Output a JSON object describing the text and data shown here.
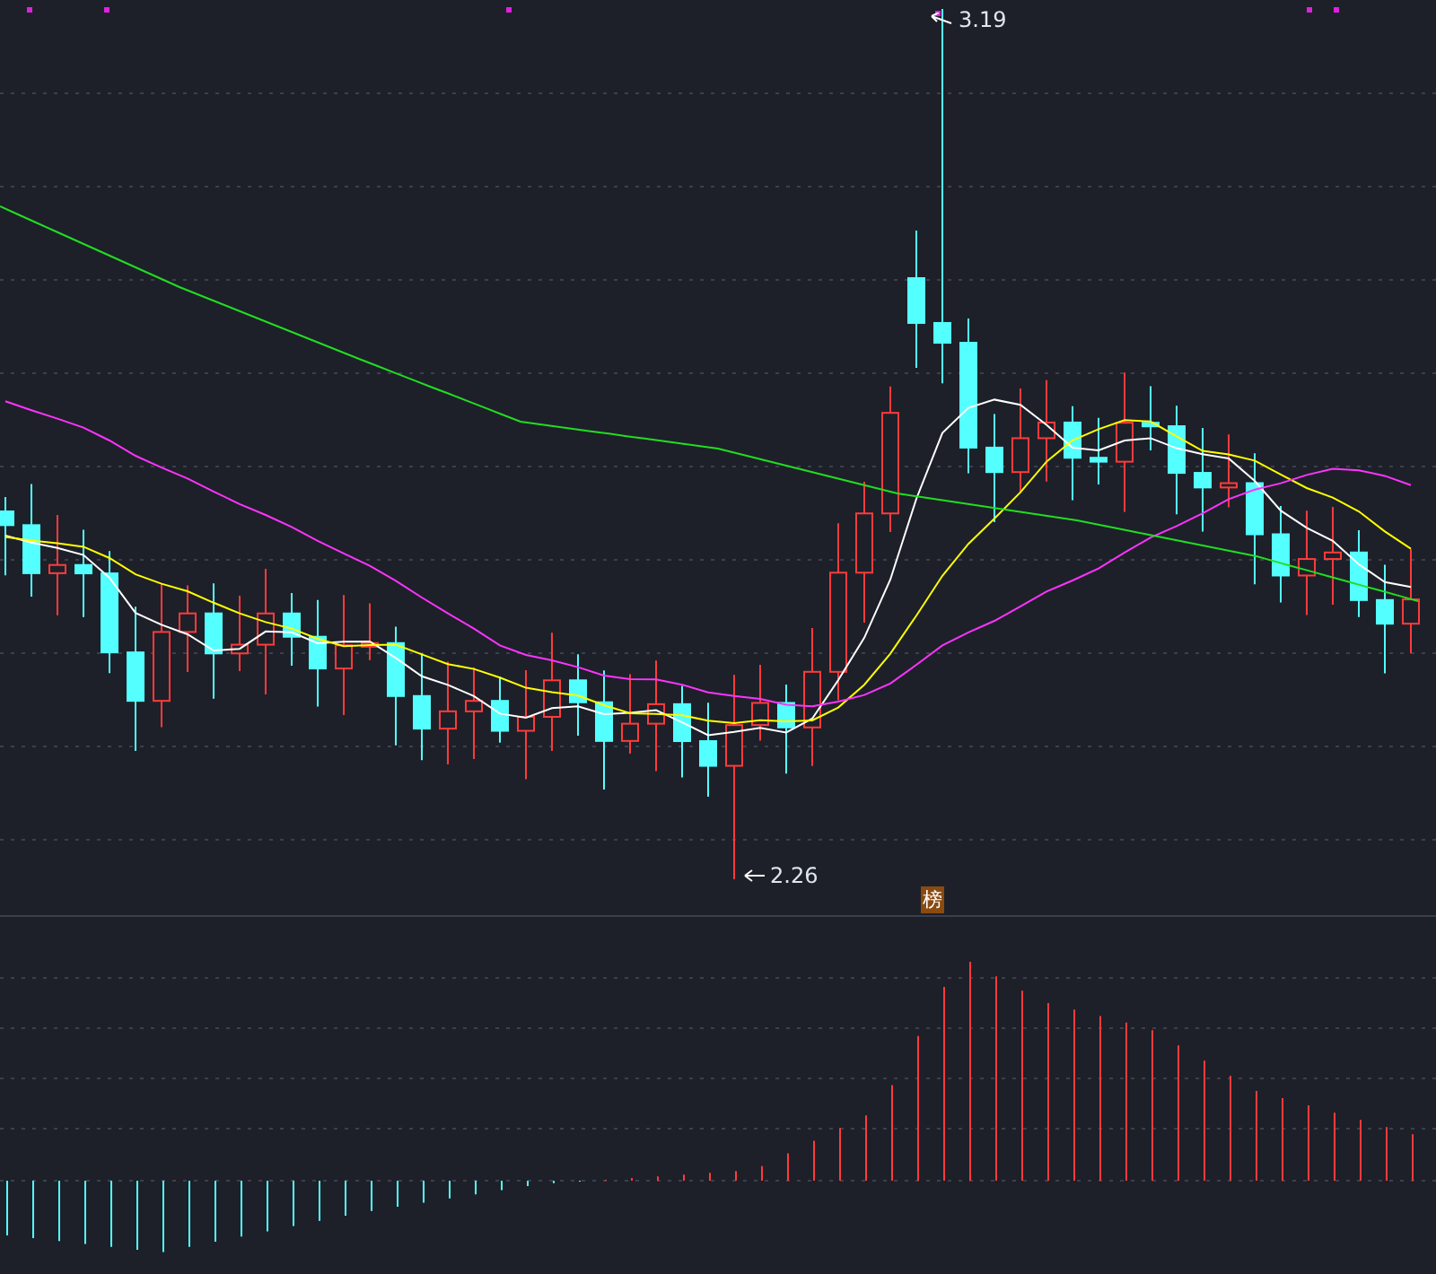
{
  "price_chart": {
    "high_label": "3.19",
    "low_label": "2.26",
    "badge": "榜"
  }
}
